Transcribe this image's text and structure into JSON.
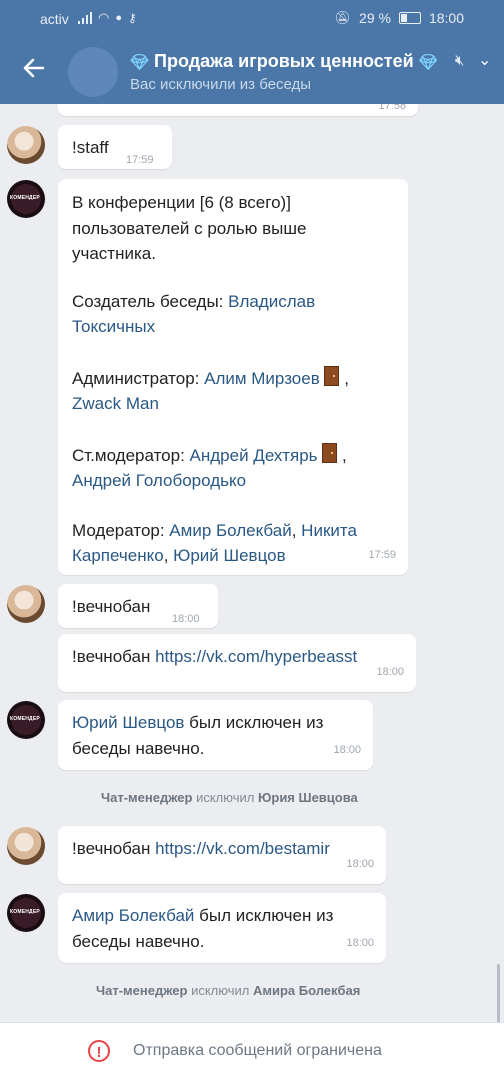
{
  "status_bar": {
    "carrier": "activ",
    "battery": "29 %",
    "time": "18:00"
  },
  "header": {
    "title": "Продажа игровых ценностей",
    "subtitle": "Вас исключили из беседы",
    "back_icon": "back-arrow-icon",
    "mute_icon": "mute-icon",
    "dropdown_icon": "chevron-down-icon"
  },
  "messages": {
    "top_partial_time": "17:58",
    "m1": {
      "text": "!staff",
      "time": "17:59"
    },
    "m2": {
      "line1": "В конференции [6 (8 всего)]",
      "line2": "пользователей с ролью выше",
      "line3": "участника.",
      "creator_label": "Создатель беседы: ",
      "creator_name1": "Владислав",
      "creator_name2": "Токсичных",
      "admin_label": "Администратор: ",
      "admin_name1": "Алим Мирзоев",
      "admin_name2": "Zwack Man",
      "senior_label": "Ст.модератор: ",
      "senior_name1": "Андрей Дехтярь",
      "senior_name2": "Андрей Голобородько",
      "mod_label": "Модератор: ",
      "mod_name1": "Амир Болекбай",
      "mod_name2": "Никита",
      "mod_name3": "Карпеченко",
      "mod_name4": "Юрий Шевцов",
      "time": "17:59"
    },
    "m3": {
      "text": "!вечнобан",
      "time": "18:00"
    },
    "m4": {
      "command": "!вечнобан",
      "link": "https://vk.com/hyperbeasst",
      "time": "18:00"
    },
    "m5": {
      "name": "Юрий Шевцов",
      "text1": " был исключен из",
      "text2": "беседы навечно.",
      "time": "18:00"
    },
    "sys1": {
      "actor": "Чат-менеджер",
      "action": " исключил ",
      "target": "Юрия Шевцова"
    },
    "m6": {
      "command": "!вечнобан",
      "link": "https://vk.com/bestamir",
      "time": "18:00"
    },
    "m7": {
      "name": "Амир Болекбай",
      "text1": " был исключен из",
      "text2": "беседы навечно.",
      "time": "18:00"
    },
    "sys2": {
      "actor": "Чат-менеджер",
      "action": " исключил ",
      "target": "Амира Болекбая"
    }
  },
  "footer": {
    "text": "Отправка сообщений ограничена",
    "icon": "warning-icon"
  }
}
